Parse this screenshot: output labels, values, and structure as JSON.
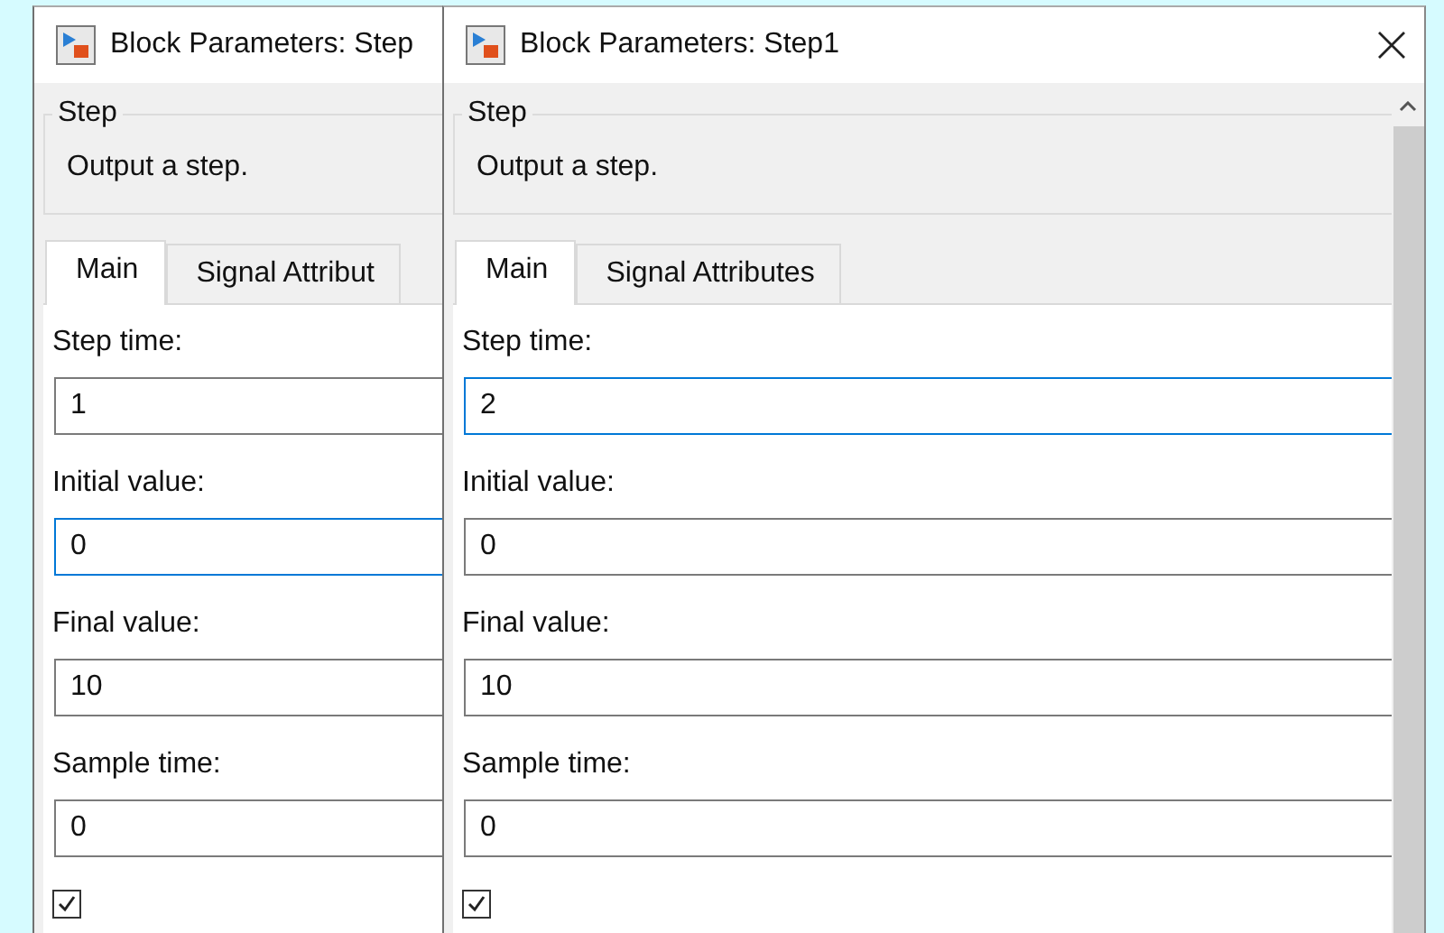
{
  "dialogs": [
    {
      "kind": "behind",
      "title": "Block Parameters: Step",
      "group_title": "Step",
      "description": "Output a step.",
      "tabs": [
        {
          "label": "Main",
          "selected": true
        },
        {
          "label": "Signal Attribut",
          "selected": false
        }
      ],
      "params": [
        {
          "label": "Step time:",
          "value": "1",
          "focused": false
        },
        {
          "label": "Initial value:",
          "value": "0",
          "focused": true
        },
        {
          "label": "Final value:",
          "value": "10",
          "focused": false
        },
        {
          "label": "Sample time:",
          "value": "0",
          "focused": false
        }
      ],
      "checkbox": {
        "checked": true
      }
    },
    {
      "kind": "front",
      "title": "Block Parameters: Step1",
      "group_title": "Step",
      "description": "Output a step.",
      "tabs": [
        {
          "label": "Main",
          "selected": true
        },
        {
          "label": "Signal Attributes",
          "selected": false
        }
      ],
      "params": [
        {
          "label": "Step time:",
          "value": "2",
          "focused": true
        },
        {
          "label": "Initial value:",
          "value": "0",
          "focused": false
        },
        {
          "label": "Final value:",
          "value": "10",
          "focused": false
        },
        {
          "label": "Sample time:",
          "value": "0",
          "focused": false
        }
      ],
      "checkbox": {
        "checked": true
      }
    }
  ]
}
